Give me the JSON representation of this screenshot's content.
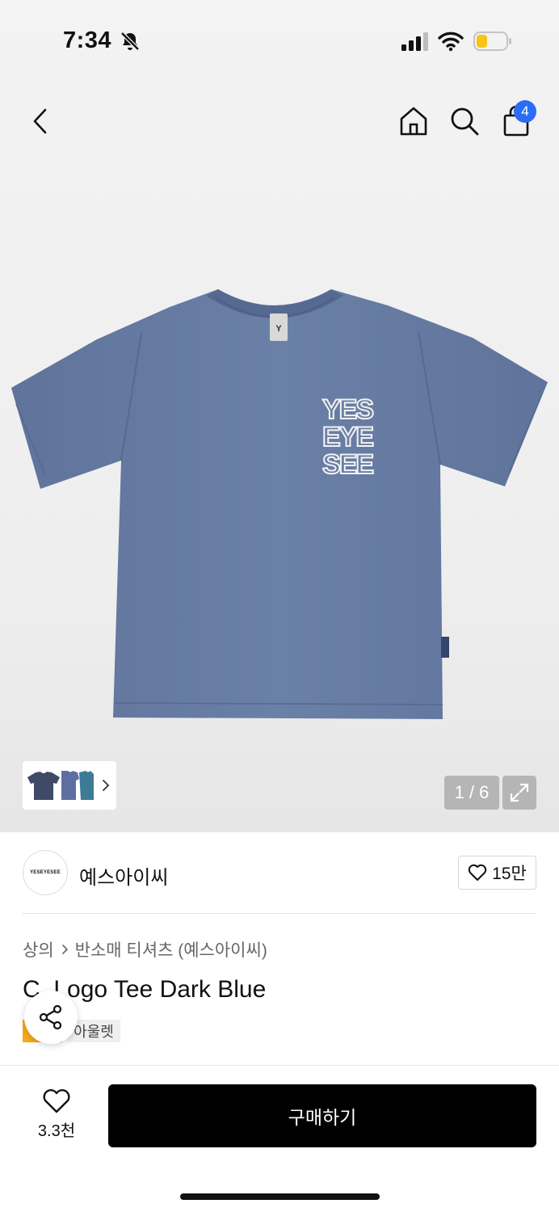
{
  "status_bar": {
    "time": "7:34",
    "icons": [
      "bell-slash-icon",
      "cellular-signal-icon",
      "wifi-icon",
      "battery-low-icon"
    ]
  },
  "nav": {
    "icons": [
      "back-chevron-icon",
      "home-icon",
      "search-icon",
      "shopping-bag-icon"
    ],
    "cart_count": "4"
  },
  "gallery": {
    "counter": "1 / 6",
    "expand_icon": "expand-arrows-icon"
  },
  "brand": {
    "logo_text": "YESEYESEE",
    "name": "예스아이씨",
    "like_count": "15만"
  },
  "breadcrumb": {
    "items": [
      "상의",
      "반소매 티셔츠 (예스아이씨)"
    ]
  },
  "product": {
    "title": "C. Logo Tee Dark Blue",
    "badges": {
      "sale": "세일",
      "outlet": "아울렛"
    },
    "print_text": [
      "YES",
      "EYE",
      "SEE"
    ],
    "label_text": "Y"
  },
  "bottom": {
    "wish_count": "3.3천",
    "buy_label": "구매하기"
  },
  "colors": {
    "shirt": "#6a7fa6",
    "badge_sale": "#f7a81b",
    "cart_badge": "#2a6cf6",
    "buy_button": "#000000"
  }
}
